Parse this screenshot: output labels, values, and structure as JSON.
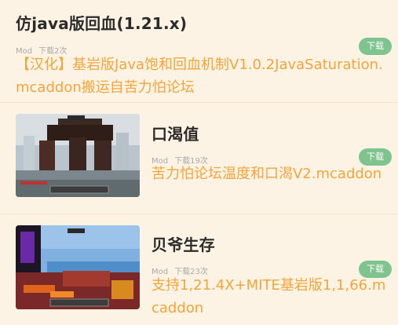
{
  "items": [
    {
      "title": "仿java版回血(1.21.x)",
      "tag": "Mod",
      "downloads": "下载2次",
      "description": "【汉化】基岩版Java饱和回血机制V1.0.2JavaSaturation.mcaddon搬运自苦力怕论坛",
      "download_label": "下载"
    },
    {
      "title": "口渴值",
      "tag": "Mod",
      "downloads": "下载19次",
      "description": "苦力怕论坛温度和口渴V2.mcaddon",
      "download_label": "下载"
    },
    {
      "title": "贝爷生存",
      "tag": "Mod",
      "downloads": "下载23次",
      "description": "支持1,21.4X+MITE基岩版1,1,66.mcaddon",
      "download_label": "下载"
    }
  ]
}
